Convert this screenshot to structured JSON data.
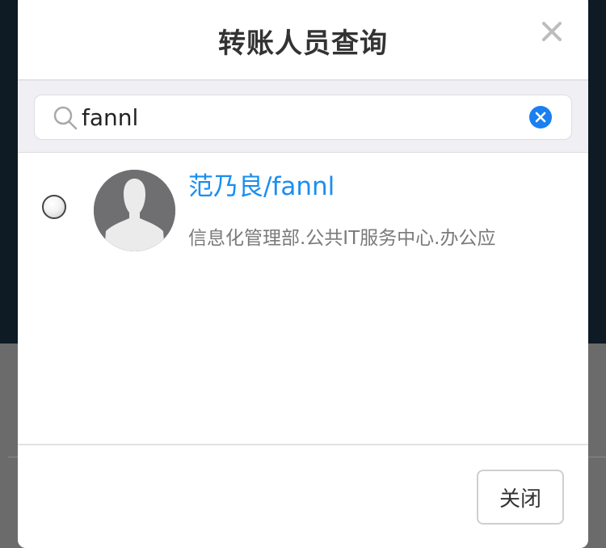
{
  "dialog": {
    "title": "转账人员查询",
    "close_icon": "close-x-icon"
  },
  "search": {
    "value": "fannl",
    "placeholder": "",
    "search_icon": "search-icon",
    "clear_icon": "clear-icon",
    "accent_color": "#1a8ef0"
  },
  "results": [
    {
      "name": "范乃良/fannl",
      "department": "信息化管理部.公共IT服务中心.办公应",
      "selected": false,
      "avatar_icon": "default-avatar-icon"
    }
  ],
  "footer": {
    "close_label": "关闭"
  }
}
